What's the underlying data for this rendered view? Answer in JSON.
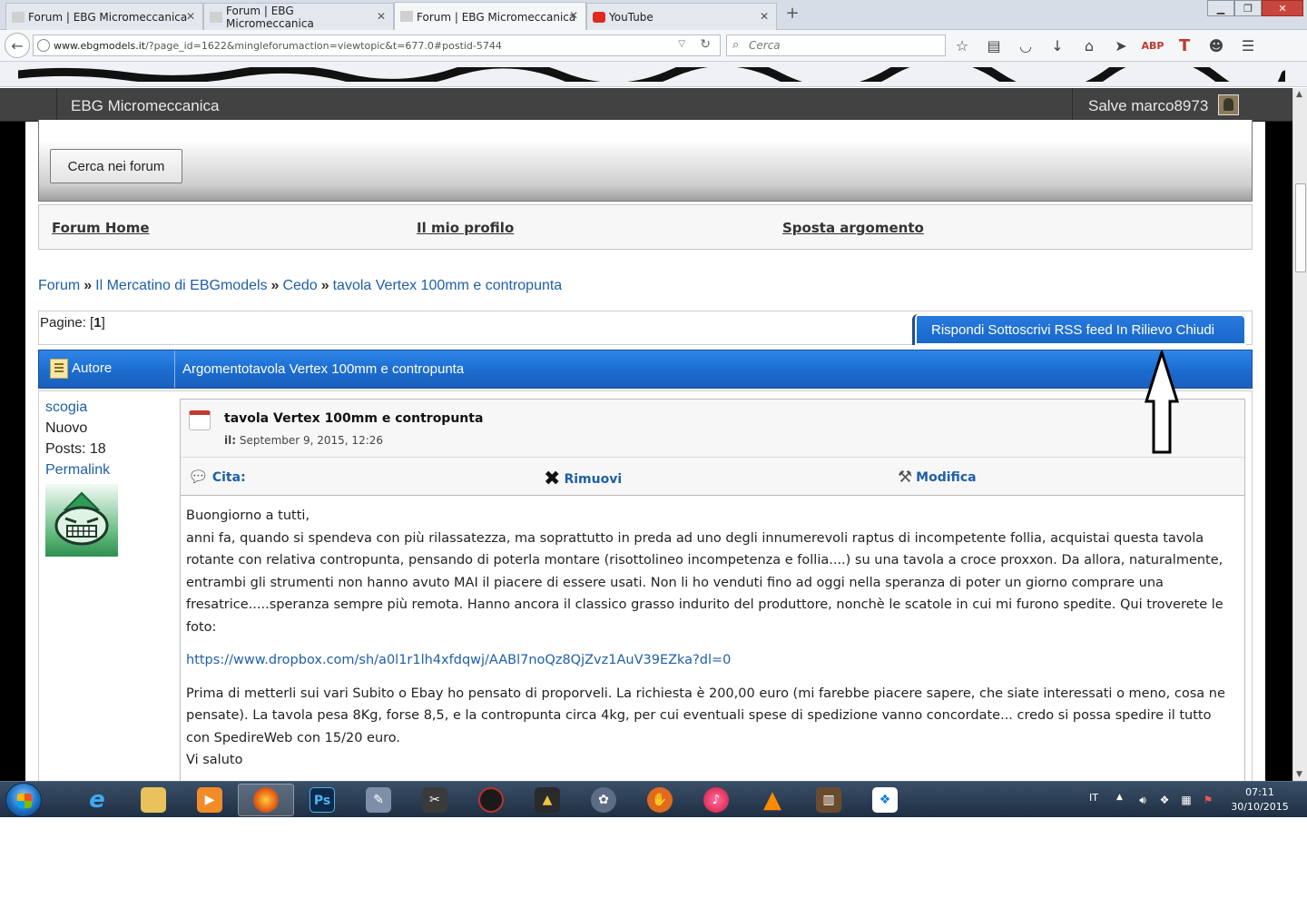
{
  "browser": {
    "tabs": [
      {
        "label": "Forum | EBG Micromeccanica",
        "active": false
      },
      {
        "label": "Forum | EBG Micromeccanica",
        "active": false
      },
      {
        "label": "Forum | EBG Micromeccanica",
        "active": true
      },
      {
        "label": "YouTube",
        "active": false
      }
    ],
    "url_host": "www.ebgmodels.it",
    "url_path": "/?page_id=1622&mingleforumaction=viewtopic&t=677.0#postid-5744",
    "search_placeholder": "Cerca"
  },
  "site": {
    "title": "EBG Micromeccanica",
    "greeting": "Salve marco8973"
  },
  "forum": {
    "search_button": "Cerca nei forum",
    "links": {
      "home": "Forum Home",
      "profile": "Il mio profilo",
      "move": "Sposta argomento"
    },
    "breadcrumb": [
      "Forum",
      "Il Mercatino di EBGmodels",
      "Cedo",
      "tavola Vertex 100mm e contropunta"
    ],
    "breadcrumb_sep": "»",
    "pages_label": "Pagine:",
    "current_page": "1",
    "actions": [
      "Rispondi",
      "Sottoscrivi",
      "RSS feed",
      "In Rilievo",
      "Chiudi"
    ],
    "header": {
      "author": "Autore",
      "topic": "Argomentotavola Vertex 100mm e contropunta"
    }
  },
  "post": {
    "author": {
      "name": "scogia",
      "rank": "Nuovo",
      "posts": "Posts: 18",
      "permalink": "Permalink"
    },
    "title": "tavola Vertex 100mm e contropunta",
    "date_label": "il:",
    "date": "September 9, 2015, 12:26",
    "actions": {
      "quote": "Cita:",
      "remove": "Rimuovi",
      "edit": "Modifica"
    },
    "body": {
      "greeting": "Buongiorno a tutti,",
      "paragraph1": "anni fa, quando si spendeva con più rilassatezza, ma soprattutto in preda ad uno degli innumerevoli raptus di incompetente follia, acquistai questa tavola rotante con relativa contropunta, pensando di poterla montare (risottolineo incompetenza e follia....) su una tavola a croce proxxon. Da allora, naturalmente, entrambi gli strumenti non hanno avuto MAI il piacere di essere usati. Non li ho venduti fino ad oggi nella speranza di poter un giorno comprare una fresatrice.....speranza sempre più remota. Hanno ancora il classico grasso indurito del produttore, nonchè le scatole in cui mi furono spedite. Qui troverete le foto:",
      "link": "https://www.dropbox.com/sh/a0l1r1lh4xfdqwj/AABl7noQz8QjZvz1AuV39EZka?dl=0",
      "paragraph2": "Prima di metterli sui vari Subito o Ebay ho pensato di proporveli. La richiesta è 200,00 euro (mi farebbe piacere sapere, che siate interessati o meno, cosa ne pensate). La tavola pesa 8Kg, forse 8,5, e la contropunta circa 4kg, per cui eventuali spese di spedizione vanno concordate... credo si possa spedire il tutto con SpedireWeb con 15/20 euro.",
      "closing": "Vi saluto"
    }
  },
  "taskbar": {
    "language": "IT",
    "time": "07:11",
    "date": "30/10/2015",
    "apps": [
      "internet-explorer",
      "file-explorer",
      "media-player",
      "firefox",
      "photoshop",
      "app-6",
      "app-7",
      "app-8",
      "app-9",
      "app-10",
      "app-11",
      "itunes",
      "vlc",
      "app-14",
      "dropbox"
    ]
  },
  "colors": {
    "link": "#1f5fa8",
    "header_bar": "#424242",
    "topic_bar": "#1b6ccf",
    "taskbar": "#1f2f43"
  }
}
